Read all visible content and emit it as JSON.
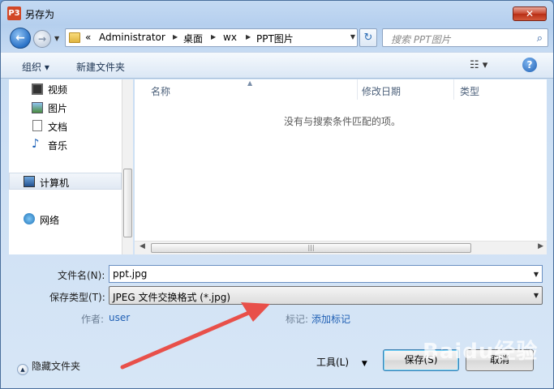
{
  "window": {
    "title": "另存为",
    "app_icon": "P3",
    "close_glyph": "✕"
  },
  "address": {
    "crumbs": [
      "Administrator",
      "桌面",
      "wx",
      "PPT图片"
    ],
    "prefix": "«"
  },
  "search": {
    "placeholder": "搜索 PPT图片"
  },
  "toolbar": {
    "organize": "组织 ▾",
    "new_folder": "新建文件夹",
    "view": "☷ ▾",
    "help": "?"
  },
  "sidebar": {
    "items": [
      {
        "label": "视频",
        "icon": "video-icon"
      },
      {
        "label": "图片",
        "icon": "pictures-icon"
      },
      {
        "label": "文档",
        "icon": "documents-icon"
      },
      {
        "label": "音乐",
        "icon": "music-icon"
      },
      {
        "label": "计算机",
        "icon": "computer-icon"
      },
      {
        "label": "网络",
        "icon": "network-icon"
      }
    ]
  },
  "file_list": {
    "columns": [
      "名称",
      "修改日期",
      "类型"
    ],
    "empty_message": "没有与搜索条件匹配的项。"
  },
  "form": {
    "filename_label": "文件名(N):",
    "filename_value": "ppt.jpg",
    "filetype_label": "保存类型(T):",
    "filetype_value": "JPEG 文件交换格式 (*.jpg)",
    "author_label": "作者:",
    "author_value": "user",
    "tags_label": "标记:",
    "tags_value": "添加标记"
  },
  "footer": {
    "hide_folders": "隐藏文件夹",
    "tools": "工具(L)",
    "save": "保存(S)",
    "cancel": "取消"
  },
  "watermark": "Baidu经验",
  "colors": {
    "annotation_arrow": "#e8504a",
    "accent": "#2a72c7"
  }
}
